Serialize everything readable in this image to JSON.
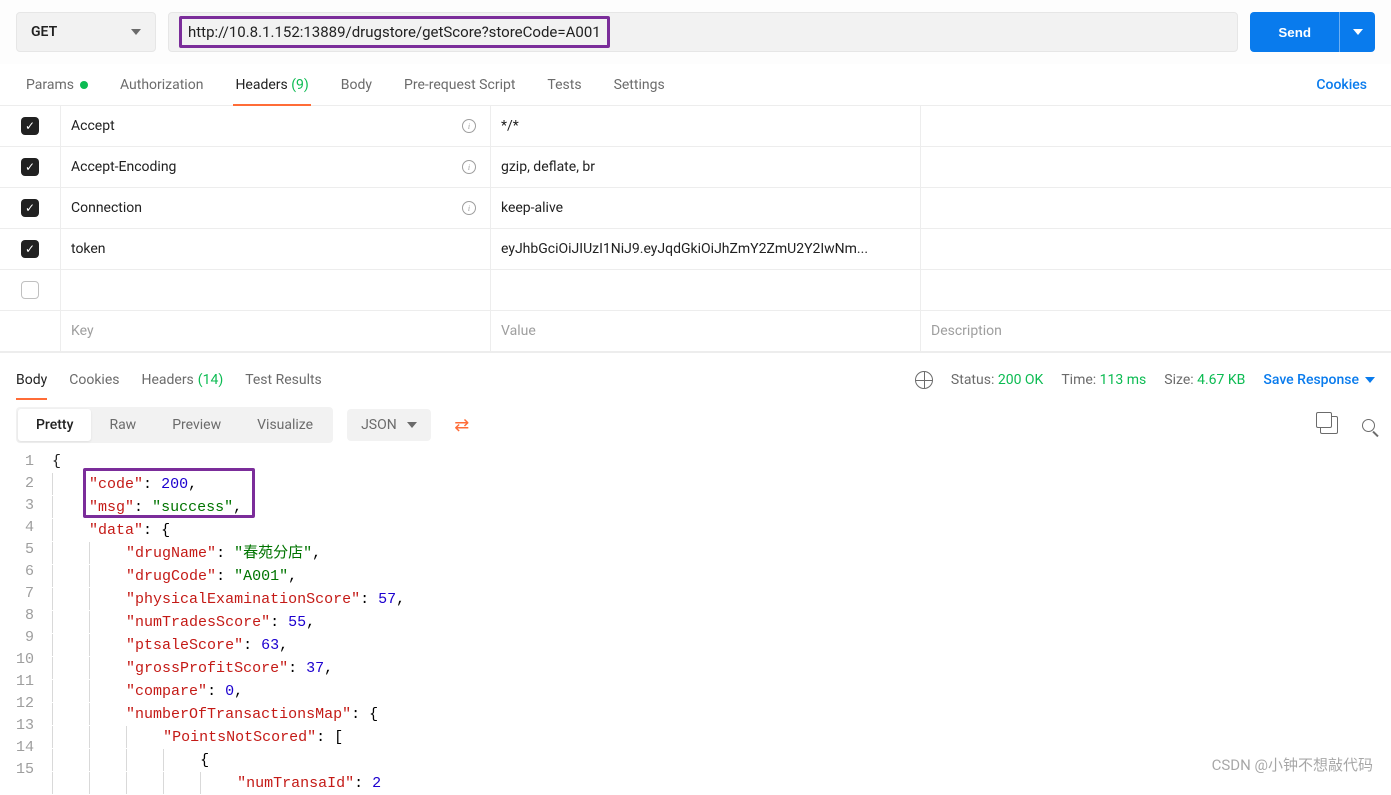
{
  "request": {
    "method": "GET",
    "url": "http://10.8.1.152:13889/drugstore/getScore?storeCode=A001",
    "send_label": "Send"
  },
  "req_tabs": {
    "params": "Params",
    "authorization": "Authorization",
    "headers": "Headers",
    "headers_count": "(9)",
    "body": "Body",
    "prerequest": "Pre-request Script",
    "tests": "Tests",
    "settings": "Settings",
    "cookies_link": "Cookies"
  },
  "headers_rows": [
    {
      "key": "Accept",
      "value": "*/*",
      "info": true,
      "checked": true
    },
    {
      "key": "Accept-Encoding",
      "value": "gzip, deflate, br",
      "info": true,
      "checked": true
    },
    {
      "key": "Connection",
      "value": "keep-alive",
      "info": true,
      "checked": true
    },
    {
      "key": "token",
      "value": "eyJhbGciOiJIUzI1NiJ9.eyJqdGkiOiJhZmY2ZmU2Y2IwNm...",
      "info": false,
      "checked": true
    }
  ],
  "headers_placeholder": {
    "key": "Key",
    "value": "Value",
    "description": "Description"
  },
  "resp_tabs": {
    "body": "Body",
    "cookies": "Cookies",
    "headers": "Headers",
    "headers_count": "(14)",
    "test_results": "Test Results"
  },
  "status": {
    "status_label": "Status:",
    "status_code": "200 OK",
    "time_label": "Time:",
    "time_value": "113 ms",
    "size_label": "Size:",
    "size_value": "4.67 KB",
    "save_response": "Save Response"
  },
  "viewbar": {
    "pretty": "Pretty",
    "raw": "Raw",
    "preview": "Preview",
    "visualize": "Visualize",
    "format": "JSON"
  },
  "json_lines": [
    {
      "n": 1,
      "html": "{"
    },
    {
      "n": 2,
      "html": "    <span class='k'>\"code\"</span><span class='p'>:</span> <span class='n'>200</span><span class='p'>,</span>"
    },
    {
      "n": 3,
      "html": "    <span class='k'>\"msg\"</span><span class='p'>:</span> <span class='s'>\"success\"</span><span class='p'>,</span>"
    },
    {
      "n": 4,
      "html": "    <span class='k'>\"data\"</span><span class='p'>:</span> <span class='p'>{</span>"
    },
    {
      "n": 5,
      "html": "        <span class='k'>\"drugName\"</span><span class='p'>:</span> <span class='s'>\"春苑分店\"</span><span class='p'>,</span>"
    },
    {
      "n": 6,
      "html": "        <span class='k'>\"drugCode\"</span><span class='p'>:</span> <span class='s'>\"A001\"</span><span class='p'>,</span>"
    },
    {
      "n": 7,
      "html": "        <span class='k'>\"physicalExaminationScore\"</span><span class='p'>:</span> <span class='n'>57</span><span class='p'>,</span>"
    },
    {
      "n": 8,
      "html": "        <span class='k'>\"numTradesScore\"</span><span class='p'>:</span> <span class='n'>55</span><span class='p'>,</span>"
    },
    {
      "n": 9,
      "html": "        <span class='k'>\"ptsaleScore\"</span><span class='p'>:</span> <span class='n'>63</span><span class='p'>,</span>"
    },
    {
      "n": 10,
      "html": "        <span class='k'>\"grossProfitScore\"</span><span class='p'>:</span> <span class='n'>37</span><span class='p'>,</span>"
    },
    {
      "n": 11,
      "html": "        <span class='k'>\"compare\"</span><span class='p'>:</span> <span class='n'>0</span><span class='p'>,</span>"
    },
    {
      "n": 12,
      "html": "        <span class='k'>\"numberOfTransactionsMap\"</span><span class='p'>:</span> <span class='p'>{</span>"
    },
    {
      "n": 13,
      "html": "            <span class='k'>\"PointsNotScored\"</span><span class='p'>:</span> <span class='p'>[</span>"
    },
    {
      "n": 14,
      "html": "                <span class='p'>{</span>"
    },
    {
      "n": 15,
      "html": "                    <span class='k'>\"numTransaId\"</span><span class='p'>:</span> <span class='n'>2</span>"
    }
  ],
  "watermark": "CSDN @小钟不想敲代码"
}
